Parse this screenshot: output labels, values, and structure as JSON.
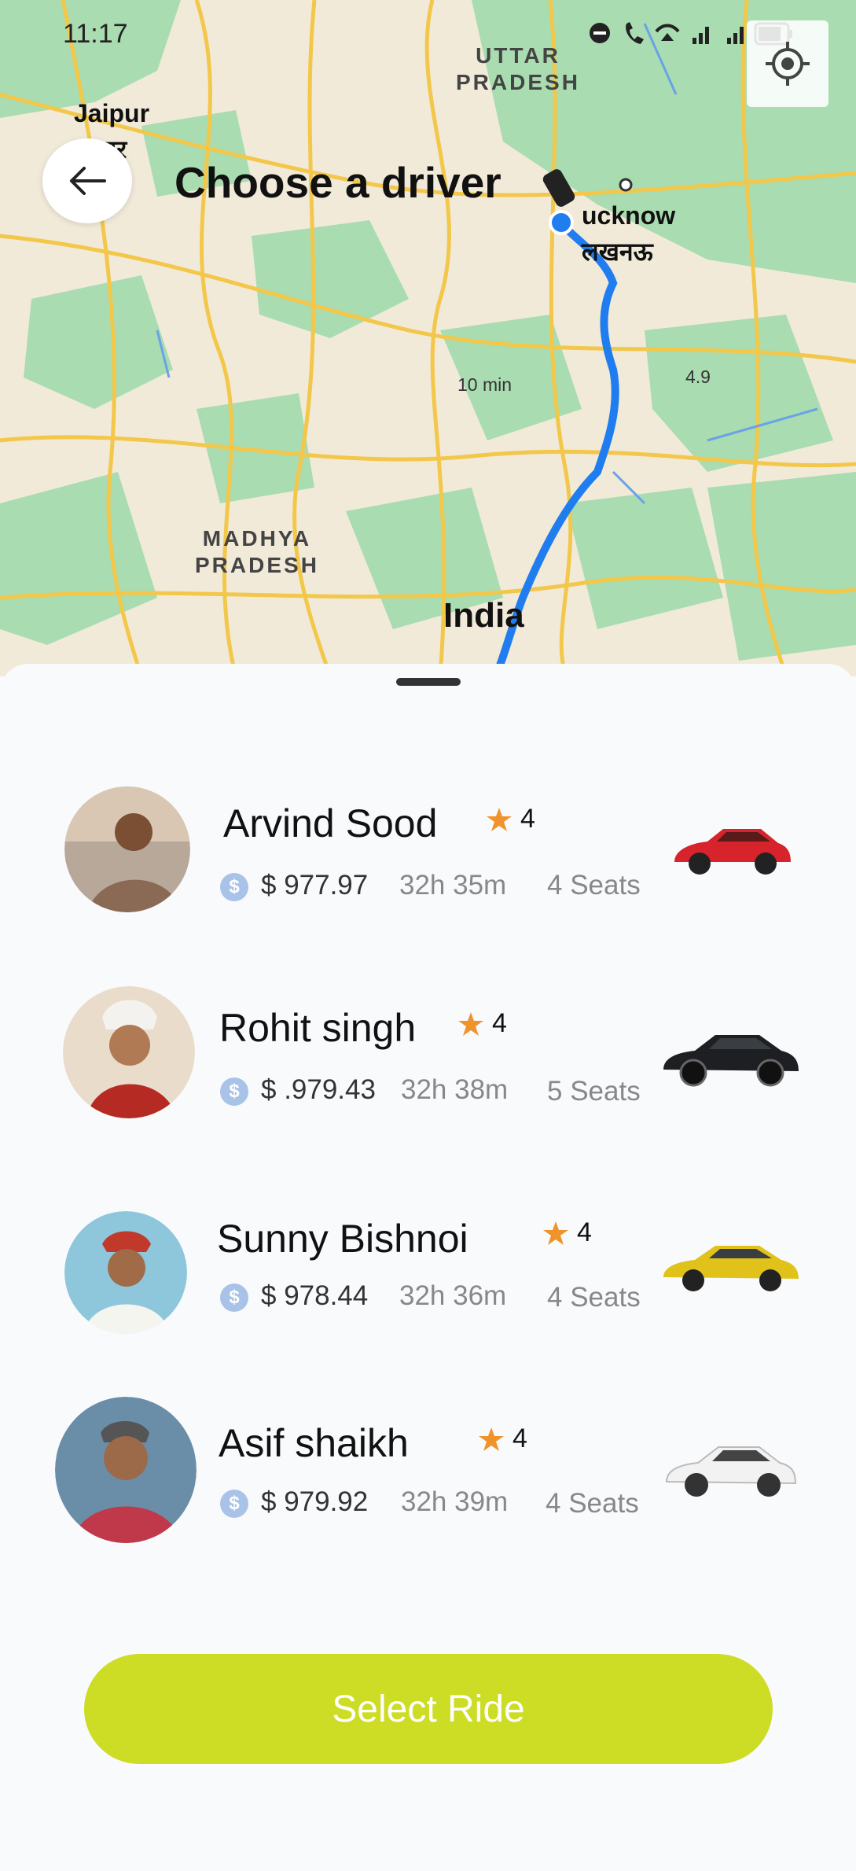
{
  "status_bar": {
    "time": "11:17"
  },
  "map": {
    "region_labels": [
      "UTTAR",
      "PRADESH",
      "MADHYA",
      "PRADESH"
    ],
    "city_labels": [
      "Jaipur",
      "पुर",
      "ucknow",
      "लखनऊ",
      "India"
    ],
    "route_labels": [
      "10 min",
      "4.9"
    ]
  },
  "header": {
    "title": "Choose a driver"
  },
  "drivers": [
    {
      "name": "Arvind Sood",
      "rating": "4",
      "price": "$ 977.97",
      "duration": "32h 35m",
      "seats": "4 Seats",
      "car_color": "#d7232b"
    },
    {
      "name": "Rohit singh",
      "rating": "4",
      "price": "$ .979.43",
      "duration": "32h 38m",
      "seats": "5 Seats",
      "car_color": "#1d1f22"
    },
    {
      "name": "Sunny Bishnoi",
      "rating": "4",
      "price": "$ 978.44",
      "duration": "32h 36m",
      "seats": "4 Seats",
      "car_color": "#e0c21a"
    },
    {
      "name": "Asif shaikh",
      "rating": "4",
      "price": "$ 979.92",
      "duration": "32h 39m",
      "seats": "4 Seats",
      "car_color": "#f2f2f2"
    }
  ],
  "icons": {
    "star_color": "#f0932b",
    "coin_symbol": "$",
    "accent": "#cddc24"
  },
  "footer": {
    "select_label": "Select Ride"
  }
}
